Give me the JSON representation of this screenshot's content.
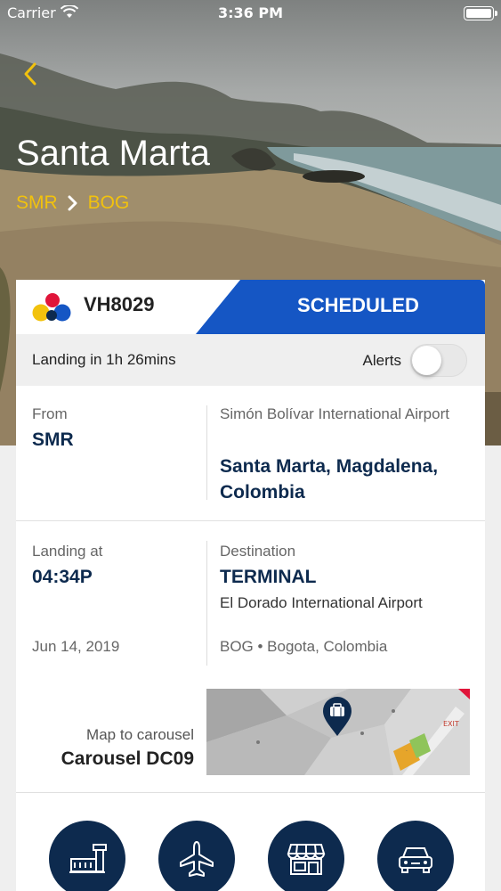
{
  "status_bar": {
    "carrier": "Carrier",
    "time": "3:36 PM"
  },
  "header": {
    "city": "Santa Marta",
    "origin_code": "SMR",
    "destination_code": "BOG"
  },
  "flight": {
    "number": "VH8029",
    "status": "SCHEDULED",
    "landing_in": "Landing in 1h 26mins",
    "alerts_label": "Alerts",
    "alerts_enabled": false
  },
  "from": {
    "label": "From",
    "code": "SMR",
    "airport": "Simón Bolívar International Airport",
    "city": "Santa Marta, Magdalena, Colombia"
  },
  "arrival": {
    "landing_label": "Landing at",
    "landing_time": "04:34P",
    "date": "Jun 14, 2019",
    "destination_label": "Destination",
    "terminal": "TERMINAL",
    "airport": "El Dorado International Airport",
    "location": "BOG • Bogota, Colombia",
    "map_label": "Map to carousel",
    "carousel": "Carousel DC09",
    "map_exit_text": "EXIT"
  },
  "actions": [
    {
      "icon": "airport-icon"
    },
    {
      "icon": "airplane-icon"
    },
    {
      "icon": "shop-icon"
    },
    {
      "icon": "car-icon"
    }
  ],
  "colors": {
    "accent_yellow": "#f2c20d",
    "status_blue": "#1556c4",
    "navy": "#0d2a4e"
  }
}
